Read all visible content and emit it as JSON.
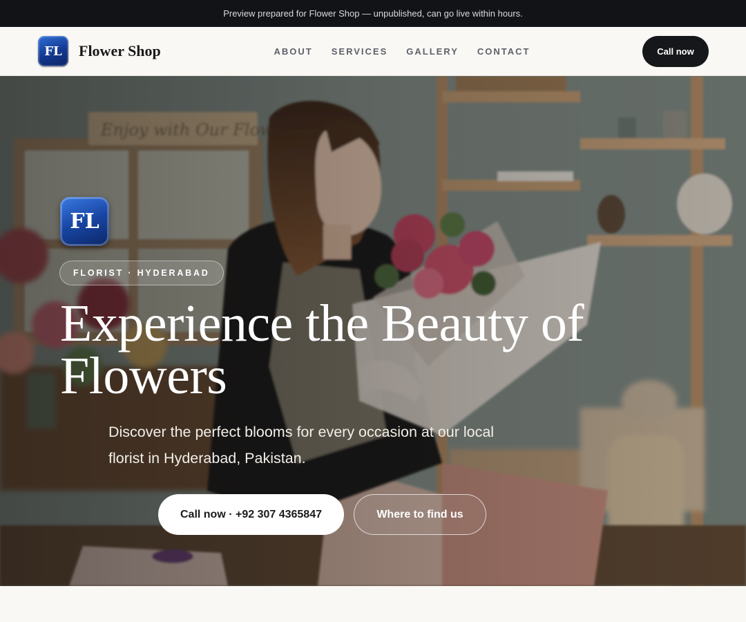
{
  "banner": {
    "text": "Preview prepared for Flower Shop — unpublished, can go live within hours."
  },
  "header": {
    "logo_initials": "FL",
    "brand_name": "Flower Shop",
    "nav": [
      "ABOUT",
      "SERVICES",
      "GALLERY",
      "CONTACT"
    ],
    "call_label": "Call now"
  },
  "hero": {
    "logo_initials": "FL",
    "badge": "FLORIST · HYDERABAD",
    "title": "Experience the Beauty of Flowers",
    "subtitle": "Discover the perfect blooms for every occasion at our local florist in Hyderabad, Pakistan.",
    "primary_button": "Call now · +92 307 4365847",
    "secondary_button": "Where to find us",
    "photo_sign_text": "Enjoy with Our Flowers"
  },
  "colors": {
    "banner_bg": "#111317",
    "header_bg": "#faf8f4",
    "dark_button": "#16171b",
    "logo_blue": "#1845a3"
  }
}
